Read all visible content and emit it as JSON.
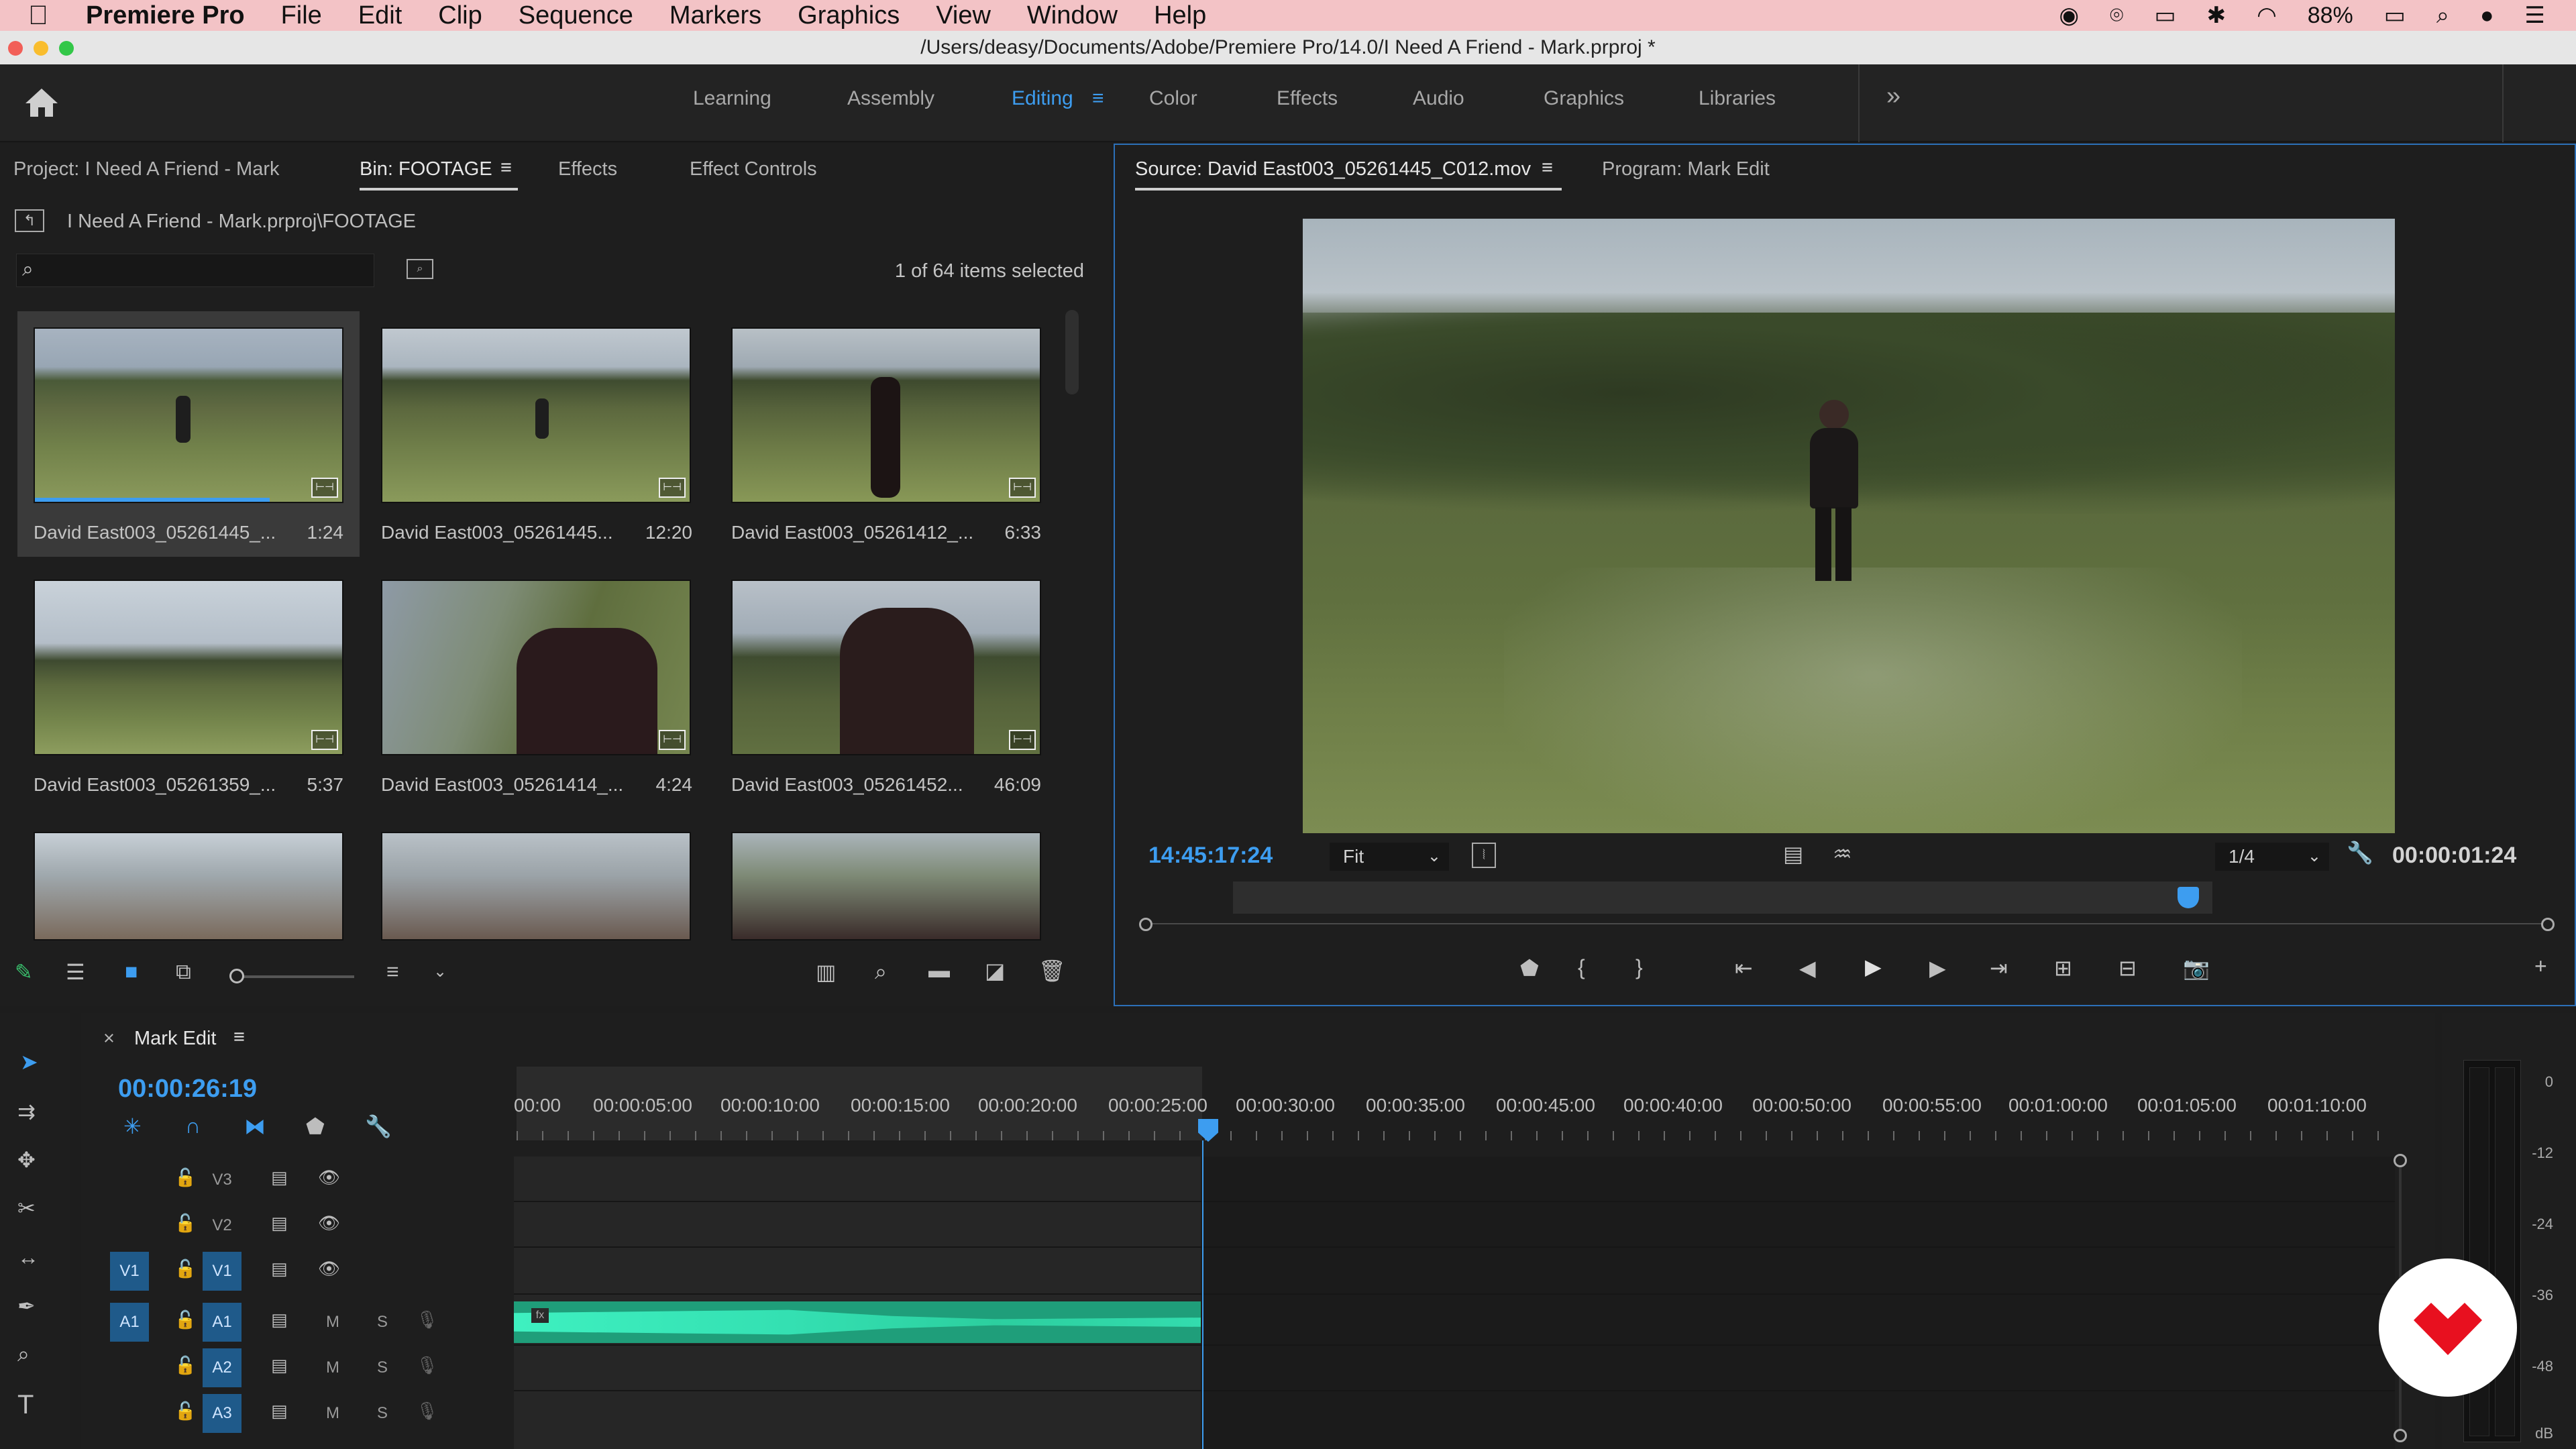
{
  "menubar": {
    "apple_icon": "apple-logo",
    "app_name": "Premiere Pro",
    "menus": [
      "File",
      "Edit",
      "Clip",
      "Sequence",
      "Markers",
      "Graphics",
      "View",
      "Window",
      "Help"
    ],
    "battery": "88%"
  },
  "titlebar": {
    "path": "/Users/deasy/Documents/Adobe/Premiere Pro/14.0/I Need A Friend - Mark.prproj *"
  },
  "workspaces": {
    "items": [
      "Learning",
      "Assembly",
      "Editing",
      "Color",
      "Effects",
      "Audio",
      "Graphics",
      "Libraries"
    ],
    "active": "Editing",
    "overflow": "»"
  },
  "project_panel": {
    "tabs": [
      "Project: I Need A Friend - Mark",
      "Bin: FOOTAGE",
      "Effects",
      "Effect Controls"
    ],
    "active_tab": "Bin: FOOTAGE",
    "path": "I Need A Friend - Mark.prproj\\FOOTAGE",
    "search_placeholder": "",
    "selection_status": "1 of 64 items selected",
    "clips": [
      {
        "name": "David East003_05261445_...",
        "duration": "1:24"
      },
      {
        "name": "David East003_05261445...",
        "duration": "12:20"
      },
      {
        "name": "David East003_05261412_...",
        "duration": "6:33"
      },
      {
        "name": "David East003_05261359_...",
        "duration": "5:37"
      },
      {
        "name": "David East003_05261414_...",
        "duration": "4:24"
      },
      {
        "name": "David East003_05261452...",
        "duration": "46:09"
      },
      {
        "name": "",
        "duration": ""
      },
      {
        "name": "",
        "duration": ""
      },
      {
        "name": "",
        "duration": ""
      }
    ]
  },
  "source_monitor": {
    "tabs": [
      "Source: David East003_05261445_C012.mov",
      "Program: Mark Edit"
    ],
    "timecode": "14:45:17:24",
    "fit": "Fit",
    "resolution": "1/4",
    "duration": "00:00:01:24"
  },
  "timeline": {
    "tab": "Mark Edit",
    "timecode": "00:00:26:19",
    "ruler": [
      "00:00",
      "00:00:05:00",
      "00:00:10:00",
      "00:00:15:00",
      "00:00:20:00",
      "00:00:25:00",
      "00:00:30:00",
      "00:00:35:00",
      "00:00:40:00",
      "00:00:45:00",
      "00:00:50:00",
      "00:00:55:00",
      "00:01:00:00",
      "00:01:05:00",
      "00:01:10:00"
    ],
    "tracks": [
      {
        "name": "V3",
        "source": ""
      },
      {
        "name": "V2",
        "source": ""
      },
      {
        "name": "V1",
        "source": "V1"
      },
      {
        "name": "A1",
        "source": "A1",
        "m": "M",
        "s": "S"
      },
      {
        "name": "A2",
        "source": "",
        "m": "M",
        "s": "S"
      },
      {
        "name": "A3",
        "source": "",
        "m": "M",
        "s": "S"
      }
    ],
    "clip_label": "fx"
  },
  "meter": {
    "labels": [
      "0",
      "-12",
      "-24",
      "-36",
      "-48",
      "dB"
    ]
  },
  "colors": {
    "accent": "#3d9df0",
    "audio_clip": "#2fd2a5",
    "menubar": "#f3c3c6"
  }
}
